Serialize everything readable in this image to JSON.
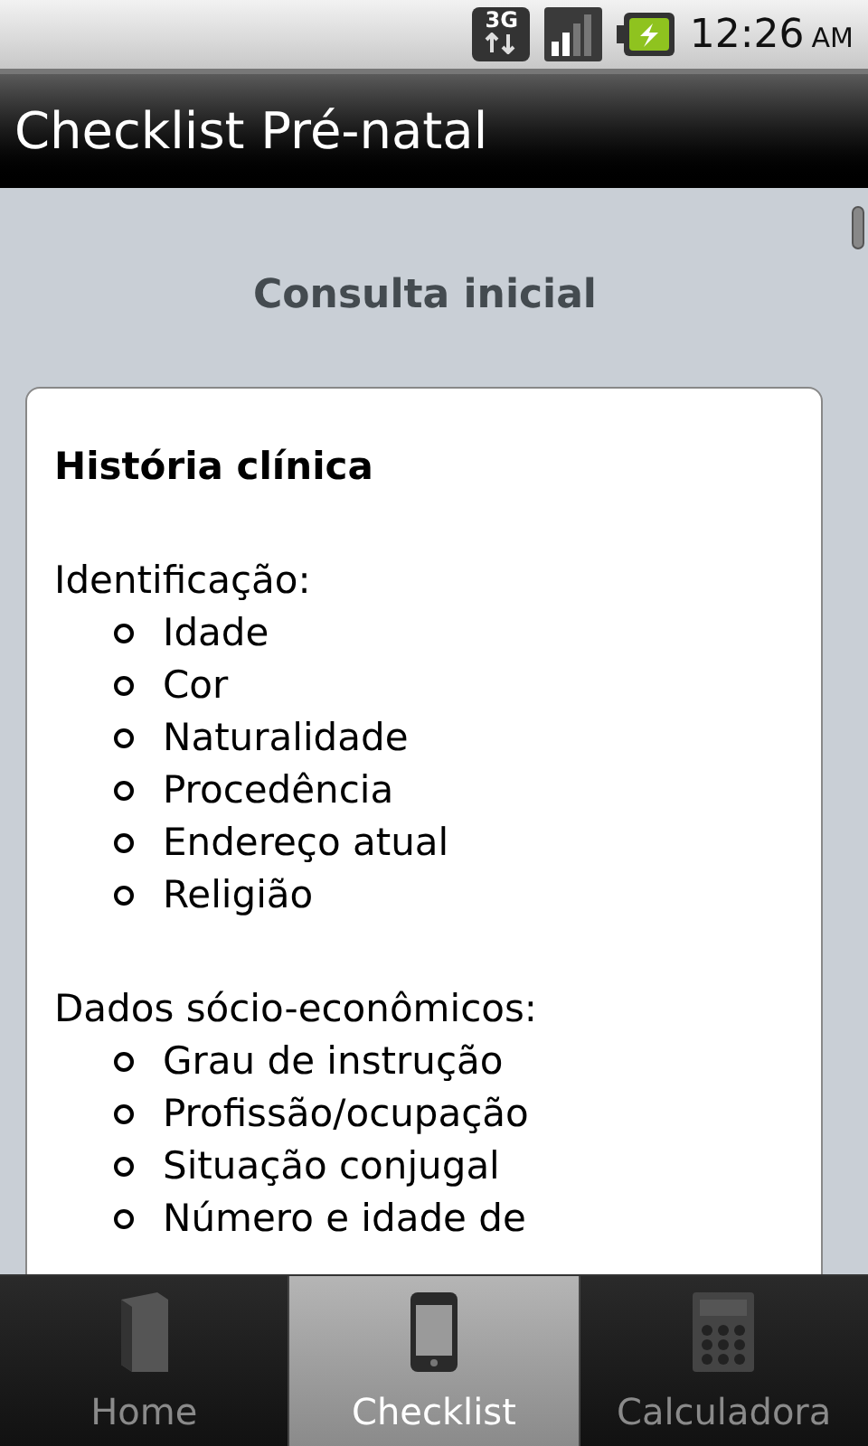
{
  "status_bar": {
    "network": "3G",
    "time": "12:26",
    "period": "AM"
  },
  "title": "Checklist Pré-natal",
  "section_title": "Consulta inicial",
  "card": {
    "heading": "História clínica",
    "groups": [
      {
        "label": "Identificação:",
        "items": [
          "Idade",
          "Cor",
          "Naturalidade",
          "Procedência",
          "Endereço atual",
          "Religião"
        ]
      },
      {
        "label": "Dados sócio-econômicos:",
        "items": [
          "Grau de instrução",
          "Profissão/ocupação",
          "Situação conjugal",
          "Número e idade de"
        ]
      }
    ]
  },
  "tabs": [
    {
      "label": "Home",
      "kind": "book",
      "selected": false
    },
    {
      "label": "Checklist",
      "kind": "phone",
      "selected": true
    },
    {
      "label": "Calculadora",
      "kind": "calculator",
      "selected": false
    }
  ]
}
